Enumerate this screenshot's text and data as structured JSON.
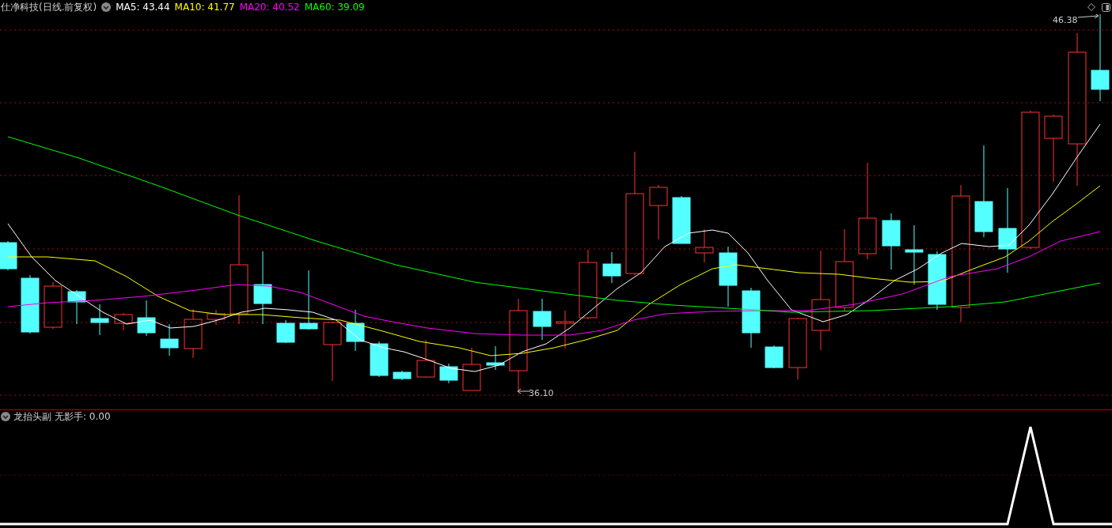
{
  "main_chart": {
    "title": "仕净科技(日线.前复权)",
    "ma_readings": [
      {
        "label": "MA5: 43.44",
        "color": "#ffffff"
      },
      {
        "label": "MA10: 41.77",
        "color": "#ffff00"
      },
      {
        "label": "MA20: 40.52",
        "color": "#ff00ff"
      },
      {
        "label": "MA60: 39.09",
        "color": "#00ff00"
      }
    ],
    "high_label": "46.38",
    "low_label": "36.10"
  },
  "indicator_panel": {
    "name": "龙抬头副",
    "reading": "无影手: 0.00"
  }
}
